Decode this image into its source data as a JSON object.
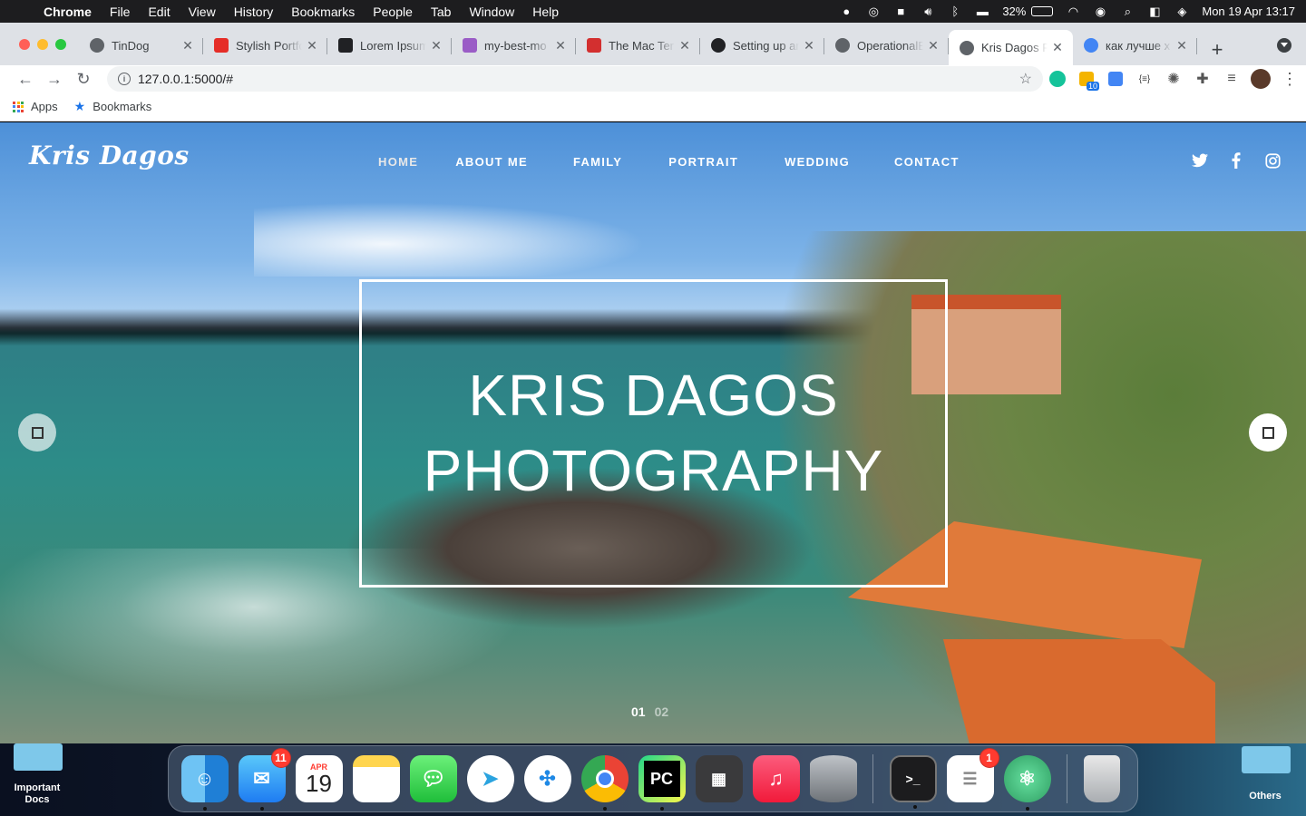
{
  "menubar": {
    "app_name": "Chrome",
    "items": [
      "File",
      "Edit",
      "View",
      "History",
      "Bookmarks",
      "People",
      "Tab",
      "Window",
      "Help"
    ],
    "battery_percent": "32%",
    "battery_level": 0.32,
    "datetime": "Mon 19 Apr  13:17"
  },
  "tabs": [
    {
      "title": "TinDog",
      "favicon": "globe-icon",
      "color": "#5f6368"
    },
    {
      "title": "Stylish Portfo",
      "favicon": "s-icon",
      "color": "#e52d27"
    },
    {
      "title": "Lorem Ipsum",
      "favicon": "l-icon",
      "color": "#202124"
    },
    {
      "title": "my-best-mo",
      "favicon": "h-icon",
      "color": "#9a5cc6"
    },
    {
      "title": "The Mac Ter",
      "favicon": "mac-icon",
      "color": "#d32f2f"
    },
    {
      "title": "Setting up ar",
      "favicon": "github-icon",
      "color": "#202124"
    },
    {
      "title": "OperationalE",
      "favicon": "globe-icon",
      "color": "#5f6368"
    },
    {
      "title": "Kris Dagos P",
      "favicon": "globe-icon",
      "color": "#5f6368",
      "active": true
    },
    {
      "title": "как лучше х",
      "favicon": "google-icon",
      "color": "#4285f4"
    }
  ],
  "toolbar": {
    "url": "127.0.0.1:5000/#",
    "extension_badge": "10"
  },
  "bookmarks": {
    "apps_label": "Apps",
    "bookmarks_label": "Bookmarks"
  },
  "site": {
    "logo": "Kris Dagos",
    "nav": [
      "HOME",
      "ABOUT ME",
      "FAMILY",
      "PORTRAIT",
      "WEDDING",
      "CONTACT"
    ],
    "hero_line1": "KRIS DAGOS",
    "hero_line2": "PHOTOGRAPHY",
    "pager": [
      "01",
      "02"
    ],
    "social": [
      "twitter-icon",
      "facebook-icon",
      "instagram-icon"
    ]
  },
  "desktop": {
    "left_folder": "Important\nDocs",
    "right_folder": "Others"
  },
  "dock": {
    "mail_badge": "11",
    "calendar_month": "APR",
    "calendar_day": "19",
    "reminders_badge": "1",
    "apps": [
      "Finder",
      "Mail",
      "Calendar",
      "Notes",
      "Messages",
      "Telegram",
      "Safari",
      "Chrome",
      "PyCharm",
      "Calculator",
      "Music",
      "Database",
      "Terminal",
      "Reminders",
      "Atom",
      "Trash"
    ]
  }
}
